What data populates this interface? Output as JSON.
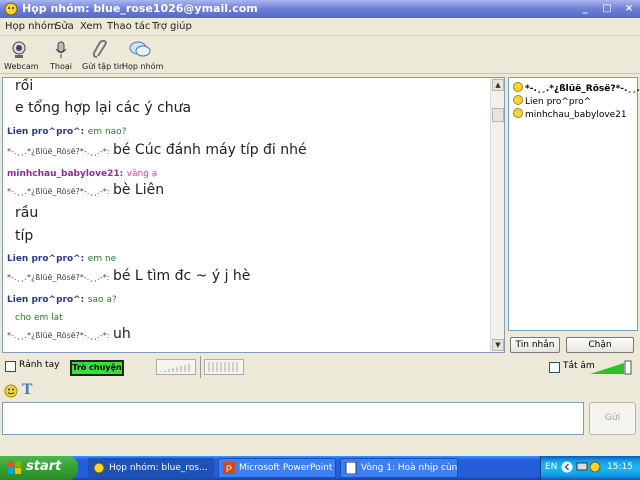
{
  "window": {
    "title": "Họp nhóm:  blue_rose1026@ymail.com",
    "controls": [
      "_",
      "□",
      "×"
    ]
  },
  "menu": [
    "Họp nhóm",
    "Sửa",
    "Xem",
    "Thao tác",
    "Trợ giúp"
  ],
  "toolbar": [
    {
      "label": "Webcam",
      "icon": "webcam-icon"
    },
    {
      "label": "Thoại",
      "icon": "microphone-icon"
    },
    {
      "label": "Gửi tập tin",
      "icon": "paperclip-icon"
    },
    {
      "label": "Họp nhóm",
      "icon": "group-chat-icon"
    }
  ],
  "chat": {
    "messages": [
      {
        "sender": "",
        "text": "rồi",
        "style": "big"
      },
      {
        "sender": "",
        "text": "e tổng hợp lại các ý chưa",
        "style": "big"
      },
      {
        "sender": "Lien pro^pro^:",
        "text": "em nao?",
        "style": "small-green"
      },
      {
        "sender": "*-.¸¸.*¿ßlüë_Rösë?*-.¸¸.-*:",
        "text": "bé Cúc đánh máy típ đi nhé",
        "style": "big"
      },
      {
        "sender": "minhchau_babylove21:",
        "text": "vâng ạ",
        "style": "small-pink"
      },
      {
        "sender": "*-.¸¸.*¿ßlüë_Rösë?*-.¸¸.-*:",
        "text": "bè Liên",
        "style": "big"
      },
      {
        "sender": "",
        "text": "rầu",
        "style": "big"
      },
      {
        "sender": "",
        "text": "típ",
        "style": "big"
      },
      {
        "sender": "Lien pro^pro^:",
        "text": "em ne",
        "style": "small-green"
      },
      {
        "sender": "*-.¸¸.*¿ßlüë_Rösë?*-.¸¸.-*:",
        "text": "bé L tìm đc ~ ý j hè",
        "style": "big"
      },
      {
        "sender": "Lien pro^pro^:",
        "text": "sao a?",
        "style": "small-green"
      },
      {
        "sender": "",
        "text": "cho em lat",
        "style": "small-green"
      },
      {
        "sender": "*-.¸¸.*¿ßlüë_Rösë?*-.¸¸.-*:",
        "text": "uh",
        "style": "big"
      }
    ]
  },
  "participants": [
    "*-.¸¸.*¿ßlüë_Rösë?*-.¸¸...",
    "Lien pro^pro^",
    "minhchau_babylove21"
  ],
  "side_buttons": {
    "message": "Tin nhắn",
    "block": "Chặn"
  },
  "bottom": {
    "busy_label": "Rảnh tay",
    "talk_label": "Trò chuyện",
    "mute_label": "Tắt âm"
  },
  "input": {
    "value": "",
    "send_label": "Gửi"
  },
  "taskbar": {
    "start_label": "start",
    "tasks": [
      {
        "label": "Họp nhóm:  blue_ros...",
        "active": true
      },
      {
        "label": "Microsoft PowerPoint ...",
        "active": false
      },
      {
        "label": "Vòng 1: Hoà nhịp cùn...",
        "active": false
      }
    ],
    "lang": "EN",
    "clock": "15:15"
  },
  "colors": {
    "title_bar": "#6e7fd6",
    "taskbar": "#245edb",
    "start": "#34a234",
    "talk_button": "#38e038"
  }
}
